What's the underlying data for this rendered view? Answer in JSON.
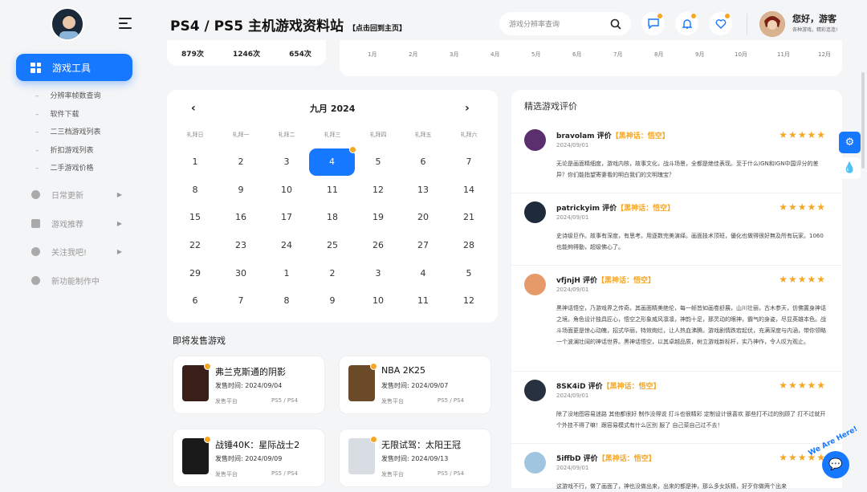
{
  "header": {
    "title": "PS4 / PS5 主机游戏资料站",
    "home_link": "【点击回到主页】",
    "search_placeholder": "游戏分辨率查询",
    "greeting": "您好，游客",
    "greeting_sub": "各种游戏，精彩连连!"
  },
  "sidebar": {
    "primary": "游戏工具",
    "sub_items": [
      "分辨率帧数查询",
      "软件下载",
      "二三档游戏列表",
      "折扣游戏列表",
      "二手游戏价格"
    ],
    "items": [
      "日常更新",
      "游戏推荐",
      "关注我吧!",
      "新功能制作中"
    ]
  },
  "stats": [
    "879次",
    "1246次",
    "654次"
  ],
  "months": [
    "1月",
    "2月",
    "3月",
    "4月",
    "5月",
    "6月",
    "7月",
    "8月",
    "9月",
    "10月",
    "11月",
    "12月"
  ],
  "calendar": {
    "title": "九月 2024",
    "weekdays": [
      "礼拜日",
      "礼拜一",
      "礼拜二",
      "礼拜三",
      "礼拜四",
      "礼拜五",
      "礼拜六"
    ],
    "days": [
      "1",
      "2",
      "3",
      "4",
      "5",
      "6",
      "7",
      "8",
      "9",
      "10",
      "11",
      "12",
      "13",
      "14",
      "15",
      "16",
      "17",
      "18",
      "19",
      "20",
      "21",
      "22",
      "23",
      "24",
      "25",
      "26",
      "27",
      "28",
      "29",
      "30",
      "1",
      "2",
      "3",
      "4",
      "5",
      "6",
      "7",
      "8",
      "9",
      "10",
      "11",
      "12"
    ],
    "today_index": 3
  },
  "upcoming": {
    "title": "即将发售游戏",
    "date_prefix": "发售时间:",
    "platform_label": "发售平台",
    "games": [
      {
        "name": "弗兰克斯通的阴影",
        "date": "2024/09/04",
        "platform": "PS5 / PS4"
      },
      {
        "name": "NBA 2K25",
        "date": "2024/09/07",
        "platform": "PS5 / PS4"
      },
      {
        "name": "战锤40K：星际战士2",
        "date": "2024/09/09",
        "platform": "PS5 / PS4"
      },
      {
        "name": "无限试驾：太阳王冠",
        "date": "2024/09/13",
        "platform": "PS5 / PS4"
      }
    ]
  },
  "reviews": {
    "title": "精选游戏评价",
    "items": [
      {
        "user": "bravolam 评价",
        "game": "【黑神话：悟空】",
        "date": "2024/09/01",
        "text": "无论是画面精细度，游戏内核，故事文化，战斗场景，全都是绝佳表现。至于什么IGN和IGN中国评分的差异？你们能指望寄妻看的明白我们的文明瑰宝？"
      },
      {
        "user": "patrickyim 评价",
        "game": "【黑神话：悟空】",
        "date": "2024/09/01",
        "text": "史诗级巨作。故事有深度，有思考。用逐数完美演绎。画面技术顶班，優化也做得很好無及所有玩家。1060也能夠得動，超级佛心了。"
      },
      {
        "user": "vfjnjH 评价",
        "game": "【黑神话：悟空】",
        "date": "2024/09/01",
        "text": "黑神话悟空，乃游戏界之传奇。其画面精美绝伦，每一帧皆如画卷舒展，山川壮丽，古木参天，仿佛置身神话之境。角色设计独具匠心，悟空之形象威风凛凛，神韵十足，那灵动的眼神，霸气的身姿，尽显英雄本色。战斗场面更是惊心动魄，招式华丽，特效绚烂，让人热血沸腾。游戏剧情跌宕起伏，充满深度与内涵，带你领略一个波澜壮阔的神话世界。黑神话悟空，以其卓越品质，树立游戏新标杆，实乃神作，令人叹为观止。"
      },
      {
        "user": "8SK4iD 评价",
        "game": "【黑神话：悟空】",
        "date": "2024/09/01",
        "text": "除了没地图容易迷路 其他都很好 制作没得说 打斗也很精彩 定制设计很喜欢 那些打不过的别顾了 打不过就开个外挂不得了嘛！跟容易模式有什么区别 服了 自己菜自己过不去！"
      },
      {
        "user": "5iffbD 评价",
        "game": "【黑神话：悟空】",
        "date": "2024/09/01",
        "text": "这游戏不行，做了画面了，神也没做出来，出来的都是神，那么多女妖精，好歹你做两个出来"
      }
    ]
  },
  "widgets": {
    "here_text": "We Are Here!"
  }
}
